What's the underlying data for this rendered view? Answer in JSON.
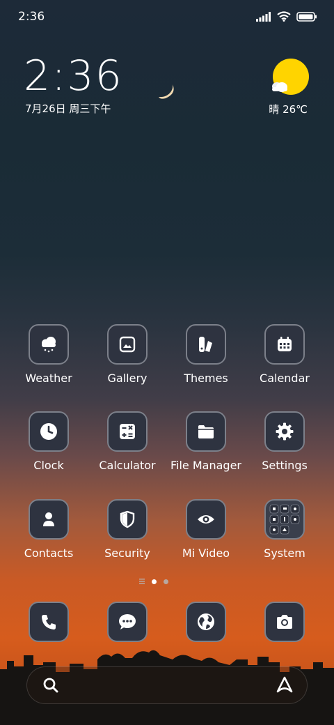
{
  "status_bar": {
    "time": "2:36"
  },
  "clock_widget": {
    "time": "2:36",
    "date": "7月26日 周三下午"
  },
  "weather_widget": {
    "summary": "晴 26℃"
  },
  "apps": [
    {
      "label": "Weather",
      "icon": "weather-icon"
    },
    {
      "label": "Gallery",
      "icon": "gallery-icon"
    },
    {
      "label": "Themes",
      "icon": "themes-icon"
    },
    {
      "label": "Calendar",
      "icon": "calendar-icon"
    },
    {
      "label": "Clock",
      "icon": "clock-icon"
    },
    {
      "label": "Calculator",
      "icon": "calculator-icon"
    },
    {
      "label": "File Manager",
      "icon": "folder-icon"
    },
    {
      "label": "Settings",
      "icon": "gear-icon"
    },
    {
      "label": "Contacts",
      "icon": "contacts-icon"
    },
    {
      "label": "Security",
      "icon": "shield-icon"
    },
    {
      "label": "Mi Video",
      "icon": "eye-icon"
    },
    {
      "label": "System",
      "icon": "folder-grid-icon"
    }
  ],
  "dock": [
    {
      "icon": "phone-icon"
    },
    {
      "icon": "message-icon"
    },
    {
      "icon": "browser-icon"
    },
    {
      "icon": "camera-icon"
    }
  ],
  "colors": {
    "tile_bg": "#2e3340",
    "tile_border": "#7c808a",
    "sun": "#ffd400"
  }
}
